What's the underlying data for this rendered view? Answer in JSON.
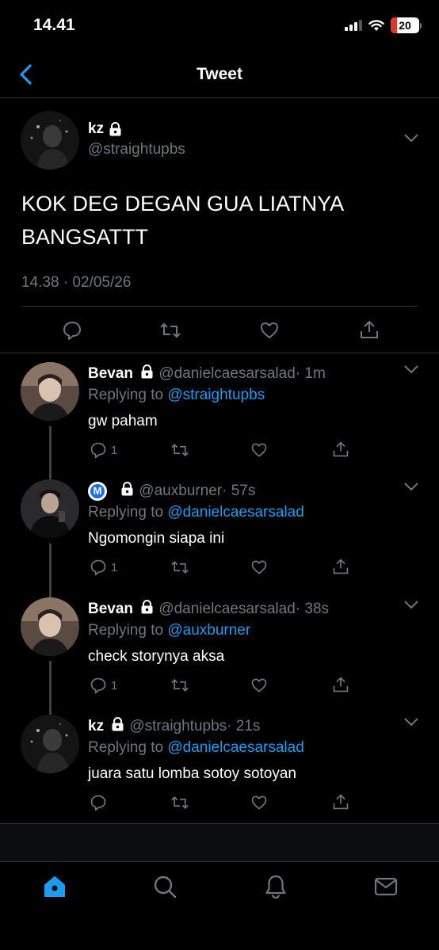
{
  "status": {
    "time": "14.41",
    "battery": "20"
  },
  "nav": {
    "title": "Tweet"
  },
  "tweet": {
    "name": "kz",
    "handle": "@straightupbs",
    "text": "KOK DEG DEGAN GUA LIATNYA BANGSATTT",
    "time": "14.38 · 02/05/26"
  },
  "replies": [
    {
      "name": "Bevan",
      "handle": "@danielcaesarsalad",
      "time": "· 1m",
      "reply_label": "Replying to ",
      "reply_to": "@straightupbs",
      "text": "gw paham",
      "reply_count": "1",
      "verified_initial": ""
    },
    {
      "name": "",
      "handle": "@auxburner",
      "time": "· 57s",
      "reply_label": "Replying to ",
      "reply_to": "@danielcaesarsalad",
      "text": "Ngomongin siapa ini",
      "reply_count": "1",
      "verified_initial": "M"
    },
    {
      "name": "Bevan",
      "handle": "@danielcaesarsalad",
      "time": "· 38s",
      "reply_label": "Replying to ",
      "reply_to": "@auxburner",
      "text": "check storynya aksa",
      "reply_count": "1",
      "verified_initial": ""
    },
    {
      "name": "kz",
      "handle": "@straightupbs",
      "time": "· 21s",
      "reply_label": "Replying to ",
      "reply_to": "@danielcaesarsalad",
      "text": "juara satu lomba sotoy sotoyan",
      "reply_count": "",
      "verified_initial": ""
    }
  ],
  "colors": {
    "accent": "#1d9bf0",
    "muted": "#71767b",
    "background": "#000000",
    "battery_low": "#e0362c"
  },
  "icons": {
    "tabs": [
      "home-icon",
      "search-icon",
      "notifications-icon",
      "messages-icon"
    ]
  }
}
